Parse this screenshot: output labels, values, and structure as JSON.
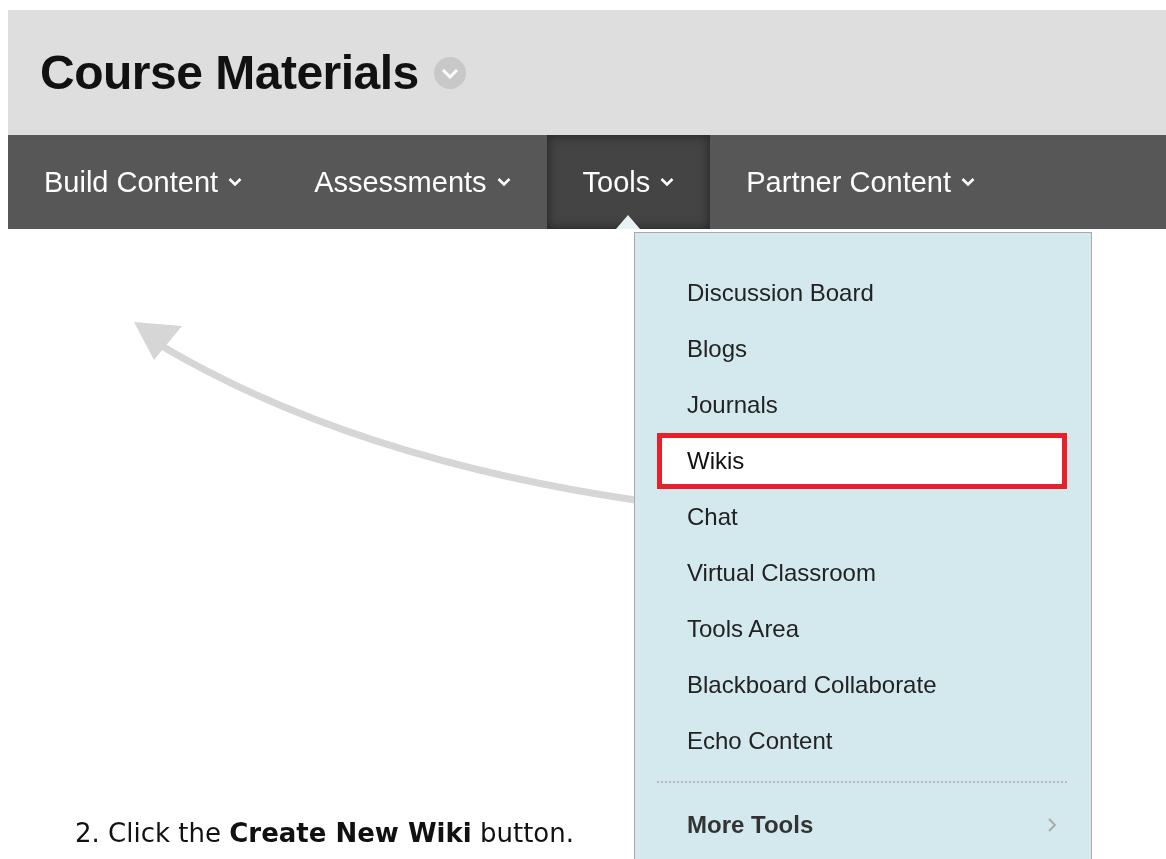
{
  "header": {
    "title": "Course Materials"
  },
  "nav": [
    {
      "label": "Build Content",
      "selected": false
    },
    {
      "label": "Assessments",
      "selected": false
    },
    {
      "label": "Tools",
      "selected": true
    },
    {
      "label": "Partner Content",
      "selected": false
    }
  ],
  "menu": {
    "items": [
      {
        "label": "Discussion Board",
        "selected": false,
        "kind": "item"
      },
      {
        "label": "Blogs",
        "selected": false,
        "kind": "item"
      },
      {
        "label": "Journals",
        "selected": false,
        "kind": "item"
      },
      {
        "label": "Wikis",
        "selected": true,
        "kind": "item"
      },
      {
        "label": "Chat",
        "selected": false,
        "kind": "item"
      },
      {
        "label": "Virtual Classroom",
        "selected": false,
        "kind": "item"
      },
      {
        "label": "Tools Area",
        "selected": false,
        "kind": "item"
      },
      {
        "label": "Blackboard Collaborate",
        "selected": false,
        "kind": "item"
      },
      {
        "label": "Echo Content",
        "selected": false,
        "kind": "item"
      },
      {
        "label": "More Tools",
        "selected": false,
        "kind": "submenu"
      }
    ]
  },
  "instruction": "2. Click the **Create New Wiki** button."
}
